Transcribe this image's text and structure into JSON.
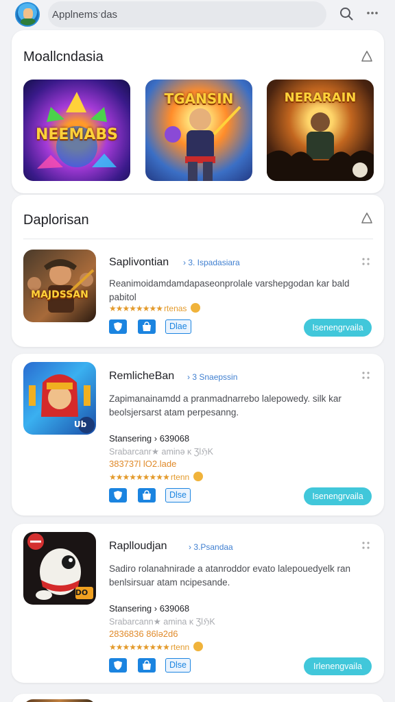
{
  "header": {
    "search_text": "Applnemsˑdas",
    "icons": [
      "avatar",
      "search-icon",
      "more-icon"
    ]
  },
  "featured": {
    "title": "Moallcndasia",
    "items": [
      {
        "label": "NEEMABS"
      },
      {
        "label": "TGANSIN"
      },
      {
        "label": "NERARAIN"
      }
    ]
  },
  "section": {
    "title": "Daplorisan"
  },
  "apps": [
    {
      "name": "Saplivontian",
      "tag": "› 3. Ispadasiara",
      "description": "Reanimoidamdamdapaseonprolale varshepgodan kar bald pabitol",
      "meta": [],
      "rating_text": "rtenas",
      "chips": [
        "Dlae"
      ],
      "cta": "Isenengrvaila",
      "icon_label": "MAJDSSAN"
    },
    {
      "name": "RemlicheBan",
      "tag": "› 3 Snaepssin",
      "description": "Zapimanainamdd a pranmadnarrebo lalepowedy. silk kar beolsjersarst atam perpesanng.",
      "meta": [
        "Stansering › 639068",
        "Srabarcanr★ aminə ĸ ƷlℌK",
        "383737l lO2.lade"
      ],
      "rating_text": "rtenn",
      "chips": [
        "Dlse"
      ],
      "cta": "Isenengrvaila",
      "icon_label": "Ub"
    },
    {
      "name": "Raplloudjan",
      "tag": "› 3.Psandaa",
      "description": "Sadiro rolanahnirade a atanroddor evato lalepouedyelk ran benlsirsuar atam ncipesande.",
      "meta": [
        "Stansering › 639068",
        "Srabarcann★ amina ĸ ƷlℌK",
        "2836836 86lə2d6"
      ],
      "rating_text": "rtenn",
      "chips": [
        "Dlse"
      ],
      "cta": "Irlenengvaila",
      "icon_label": "DO"
    }
  ],
  "colors": {
    "accent": "#41c7da",
    "chip": "#1b84e0",
    "star": "#e39a2b",
    "tag": "#3f7fd0"
  }
}
